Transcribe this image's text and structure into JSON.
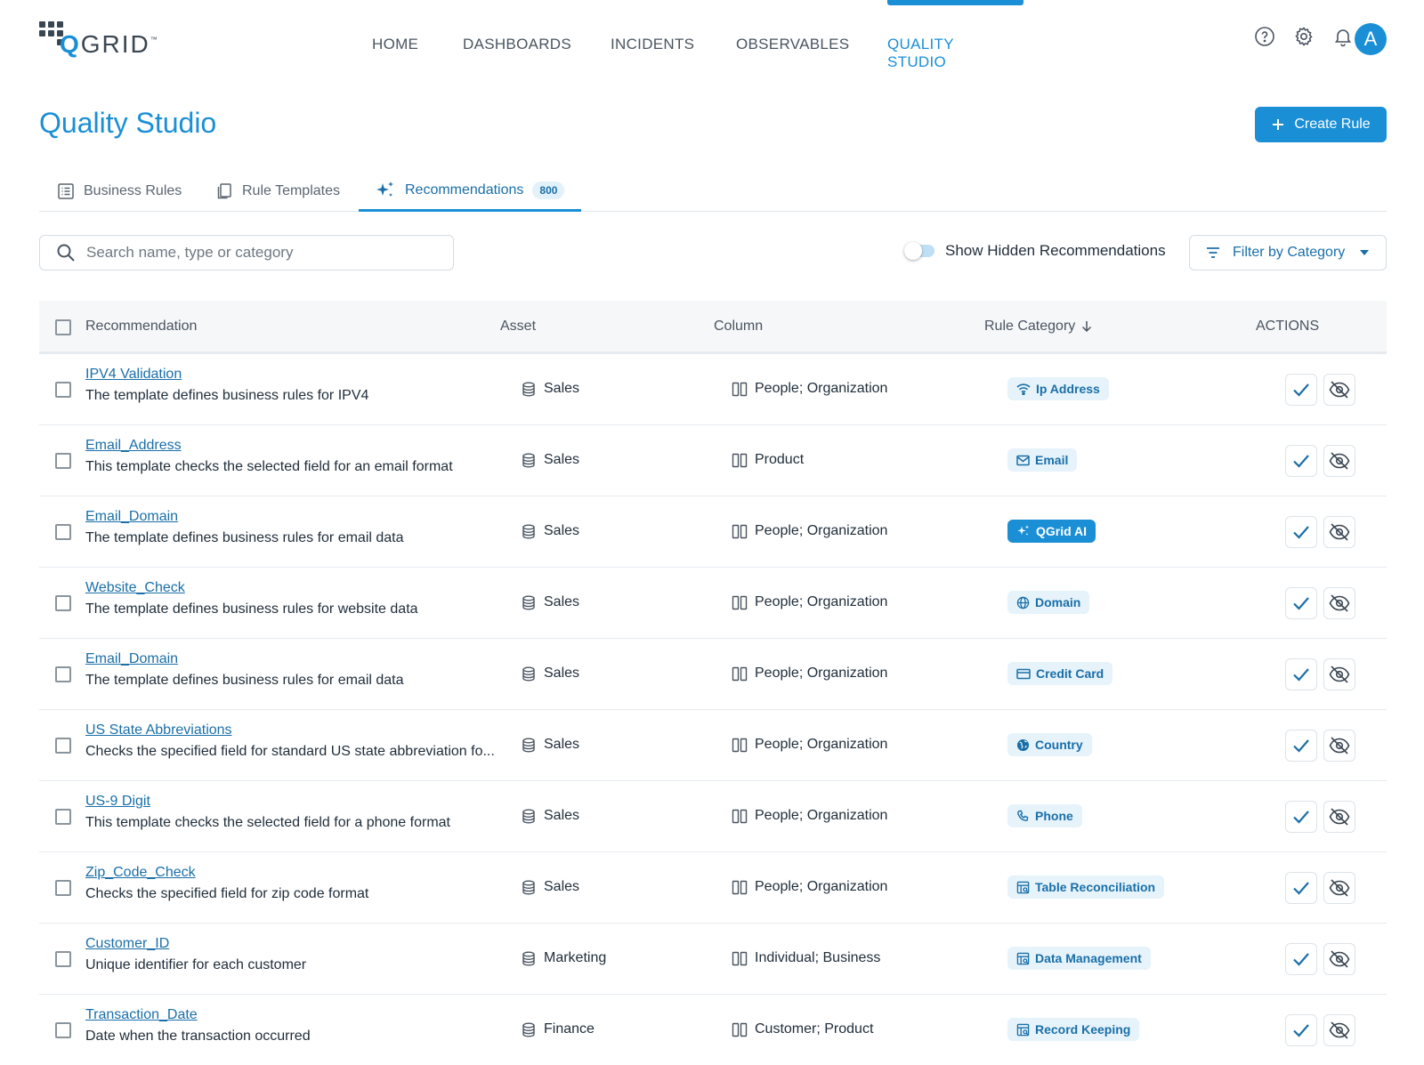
{
  "app": {
    "logo": {
      "q": "Q",
      "rest": "GRID",
      "tm": "™"
    },
    "nav": [
      "HOME",
      "DASHBOARDS",
      "INCIDENTS",
      "OBSERVABLES",
      "QUALITY STUDIO"
    ],
    "active_nav": "QUALITY STUDIO",
    "avatar_initial": "A",
    "icons": [
      "help-icon",
      "settings-icon",
      "bell-icon"
    ]
  },
  "page": {
    "title": "Quality Studio",
    "create_label": "Create Rule"
  },
  "tabs": [
    {
      "label": "Business Rules",
      "icon": "list-icon"
    },
    {
      "label": "Rule Templates",
      "icon": "copy-icon"
    },
    {
      "label": "Recommendations",
      "icon": "sparkle-icon",
      "badge": "800",
      "active": true
    }
  ],
  "search": {
    "placeholder": "Search name, type or category",
    "value": ""
  },
  "toggle": {
    "label": "Show Hidden Recommendations",
    "on": false
  },
  "filter": {
    "label": "Filter by Category"
  },
  "table": {
    "headers": {
      "recommendation": "Recommendation",
      "asset": "Asset",
      "column": "Column",
      "category": "Rule Category",
      "actions": "ACTIONS"
    },
    "rows": [
      {
        "name": "IPV4 Validation",
        "desc": "The template defines business rules for IPV4",
        "asset": "Sales",
        "column": "People; Organization",
        "category": "Ip Address",
        "cat_icon": "wifi-icon"
      },
      {
        "name": "Email_Address",
        "desc": "This template checks the selected field for an email format",
        "asset": "Sales",
        "column": "Product",
        "category": "Email",
        "cat_icon": "mail-icon"
      },
      {
        "name": "Email_Domain",
        "desc": "The template defines business rules for email data",
        "asset": "Sales",
        "column": "People; Organization",
        "category": "QGrid AI",
        "cat_icon": "sparkle-icon",
        "highlight": true
      },
      {
        "name": "Website_Check",
        "desc": "The template defines business rules for website data",
        "asset": "Sales",
        "column": "People; Organization",
        "category": "Domain",
        "cat_icon": "globe-icon"
      },
      {
        "name": "Email_Domain",
        "desc": "The template defines business rules for email data",
        "asset": "Sales",
        "column": "People; Organization",
        "category": "Credit Card",
        "cat_icon": "card-icon"
      },
      {
        "name": "US State Abbreviations",
        "desc": "Checks the specified field for standard US state abbreviation fo...",
        "asset": "Sales",
        "column": "People; Organization",
        "category": "Country",
        "cat_icon": "earth-icon"
      },
      {
        "name": "US-9 Digit",
        "desc": "This template checks the selected field for a phone format",
        "asset": "Sales",
        "column": "People; Organization",
        "category": "Phone",
        "cat_icon": "phone-icon"
      },
      {
        "name": "Zip_Code_Check",
        "desc": "Checks the specified field for zip code format",
        "asset": "Sales",
        "column": "People; Organization",
        "category": "Table Reconciliation",
        "cat_icon": "table-icon"
      },
      {
        "name": "Customer_ID",
        "desc": "Unique identifier for each customer",
        "asset": "Marketing",
        "column": "Individual; Business",
        "category": "Data Management",
        "cat_icon": "table-icon"
      },
      {
        "name": "Transaction_Date",
        "desc": "Date when the transaction occurred",
        "asset": "Finance",
        "column": "Customer; Product",
        "category": "Record Keeping",
        "cat_icon": "table-icon"
      }
    ]
  },
  "colors": {
    "accent": "#1a8fd6",
    "text": "#1f2d3a",
    "chip_bg": "#e6f3fb"
  }
}
